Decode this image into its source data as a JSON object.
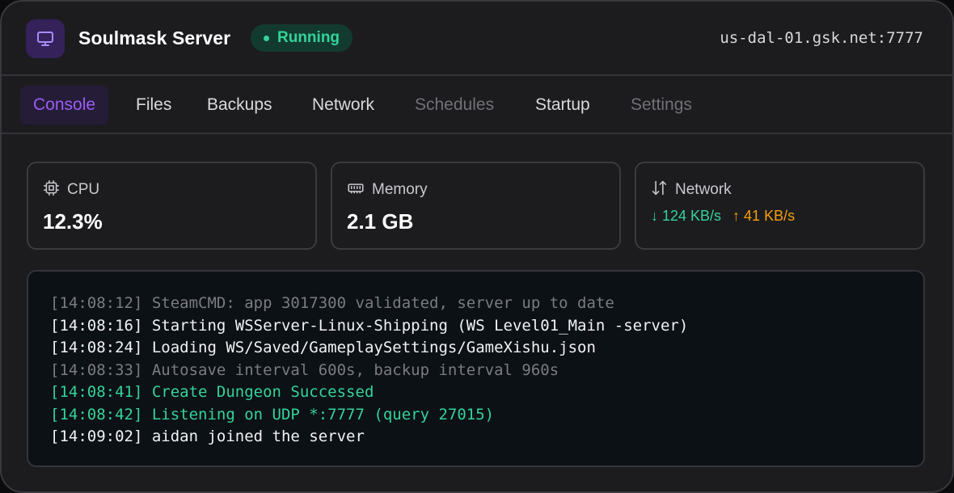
{
  "header": {
    "icon": "monitor-icon",
    "server_name": "Soulmask Server",
    "status": "Running",
    "status_color": "#34d399",
    "address": "us-dal-01.gsk.net:7777"
  },
  "tabs": [
    {
      "label": "Console",
      "state": "active"
    },
    {
      "label": "Files",
      "state": "normal"
    },
    {
      "label": "Backups",
      "state": "normal"
    },
    {
      "label": "Network",
      "state": "normal"
    },
    {
      "label": "Schedules",
      "state": "disabled"
    },
    {
      "label": "Startup",
      "state": "normal"
    },
    {
      "label": "Settings",
      "state": "disabled"
    }
  ],
  "stats": {
    "cpu": {
      "icon": "cpu-icon",
      "label": "CPU",
      "value": "12.3%"
    },
    "memory": {
      "icon": "memory-icon",
      "label": "Memory",
      "value": "2.1 GB"
    },
    "network": {
      "icon": "transfer-arrows-icon",
      "label": "Network",
      "down": "↓ 124 KB/s",
      "up": "↑ 41 KB/s"
    }
  },
  "console": {
    "lines": [
      {
        "time": "[14:08:12]",
        "text": "SteamCMD: app 3017300 validated, server up to date",
        "level": "muted"
      },
      {
        "time": "[14:08:16]",
        "text": "Starting WSServer-Linux-Shipping (WS Level01_Main -server)",
        "level": "normal"
      },
      {
        "time": "[14:08:24]",
        "text": "Loading WS/Saved/GameplaySettings/GameXishu.json",
        "level": "normal"
      },
      {
        "time": "[14:08:33]",
        "text": "Autosave interval 600s, backup interval 960s",
        "level": "muted"
      },
      {
        "time": "[14:08:41]",
        "text": "Create Dungeon Successed",
        "level": "success"
      },
      {
        "time": "[14:08:42]",
        "text": "Listening on UDP *:7777 (query 27015)",
        "level": "success"
      },
      {
        "time": "[14:09:02]",
        "text": "aidan joined the server",
        "level": "normal"
      }
    ]
  },
  "colors": {
    "accent": "#9d5cf5",
    "success": "#34d399",
    "upload": "#f59e0b",
    "background": "#1c1c1f"
  }
}
